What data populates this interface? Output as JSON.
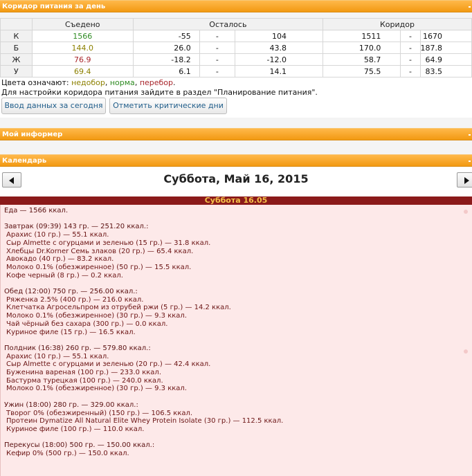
{
  "corridor_panel": {
    "title": "Коридор питания за день"
  },
  "table": {
    "headers": {
      "eaten": "Съедено",
      "left": "Осталось",
      "corridor": "Коридор"
    },
    "rows": [
      {
        "label": "К",
        "eaten": "1566",
        "eaten_color": "green",
        "left_min": "-55",
        "dash1": "-",
        "left_max": "104",
        "cor_min": "1511",
        "dash2": "-",
        "cor_max": "1670"
      },
      {
        "label": "Б",
        "eaten": "144.0",
        "eaten_color": "olive",
        "left_min": "26.0",
        "dash1": "-",
        "left_max": "43.8",
        "cor_min": "170.0",
        "dash2": "-",
        "cor_max": "187.8"
      },
      {
        "label": "Ж",
        "eaten": "76.9",
        "eaten_color": "red",
        "left_min": "-18.2",
        "dash1": "-",
        "left_max": "-12.0",
        "cor_min": "58.7",
        "dash2": "-",
        "cor_max": "64.9"
      },
      {
        "label": "У",
        "eaten": "69.4",
        "eaten_color": "olive",
        "left_min": "6.1",
        "dash1": "-",
        "left_max": "14.1",
        "cor_min": "75.5",
        "dash2": "-",
        "cor_max": "83.5"
      }
    ]
  },
  "legend": {
    "prefix": "Цвета означают: ",
    "under": "недобор",
    "sep1": ", ",
    "norm": "норма",
    "sep2": ", ",
    "over": "перебор",
    "end": "."
  },
  "hint": "Для настройки коридора питания зайдите в раздел \"Планирование питания\".",
  "buttons": {
    "enter_today": "Ввод данных за сегодня",
    "mark_critical": "Отметить критические дни"
  },
  "informer_panel": {
    "title": "Мой информер"
  },
  "calendar_panel": {
    "title": "Календарь"
  },
  "calendar": {
    "date_title": "Суббота, Май 16, 2015",
    "day_band": "Суббота 16.05"
  },
  "colors": {
    "accent": "#f29a12",
    "day_band": "#8b1a1a",
    "day_band_text": "#f5c24a",
    "day_body": "#fde9e9",
    "text_food": "#6b1414",
    "green": "#2e8b22",
    "olive": "#8c8000",
    "red": "#a8242a"
  },
  "icons": {
    "prev": "left-triangle-icon",
    "next": "right-triangle-icon",
    "collapse": "collapse-dot-icon"
  },
  "food": {
    "total": "Еда — 1566 ккал.",
    "meals": [
      {
        "title": "Завтрак (09:39) 143 гр. — 251.20 ккал.:",
        "items": [
          "Арахис (10 гр.) — 55.1 ккал.",
          "Сыр Almette с огурцами и зеленью (15 гр.) — 31.8 ккал.",
          "Хлебцы Dr.Korner Семь злаков (20 гр.) — 65.4 ккал.",
          "Авокадо (40 гр.) — 83.2 ккал.",
          "Молоко 0.1% (обезжиренное) (50 гр.) — 15.5 ккал.",
          "Кофе черный (8 гр.) — 0.2 ккал."
        ]
      },
      {
        "title": "Обед (12:00) 750 гр. — 256.00 ккал.:",
        "items": [
          "Ряженка 2.5% (400 гр.) — 216.0 ккал.",
          "Клетчатка Агросельпром из отрубей ржи (5 гр.) — 14.2 ккал.",
          "Молоко 0.1% (обезжиренное) (30 гр.) — 9.3 ккал.",
          "Чай чёрный без сахара (300 гр.) — 0.0 ккал.",
          "Куриное филе (15 гр.) — 16.5 ккал."
        ]
      },
      {
        "title": "Полдник (16:38) 260 гр. — 579.80 ккал.:",
        "items": [
          "Арахис (10 гр.) — 55.1 ккал.",
          "Сыр Almette с огурцами и зеленью (20 гр.) — 42.4 ккал.",
          "Буженина вареная (100 гр.) — 233.0 ккал.",
          "Бастурма турецкая (100 гр.) — 240.0 ккал.",
          "Молоко 0.1% (обезжиренное) (30 гр.) — 9.3 ккал."
        ]
      },
      {
        "title": "Ужин (18:00) 280 гр. — 329.00 ккал.:",
        "items": [
          "Творог 0% (обезжиренный) (150 гр.) — 106.5 ккал.",
          "Протеин Dymatize All Natural Elite Whey Protein Isolate (30 гр.) — 112.5 ккал.",
          "Куриное филе (100 гр.) — 110.0 ккал."
        ]
      },
      {
        "title": "Перекусы (18:00) 500 гр. — 150.00 ккал.:",
        "items": [
          "Кефир 0% (500 гр.) — 150.0 ккал."
        ]
      }
    ]
  }
}
